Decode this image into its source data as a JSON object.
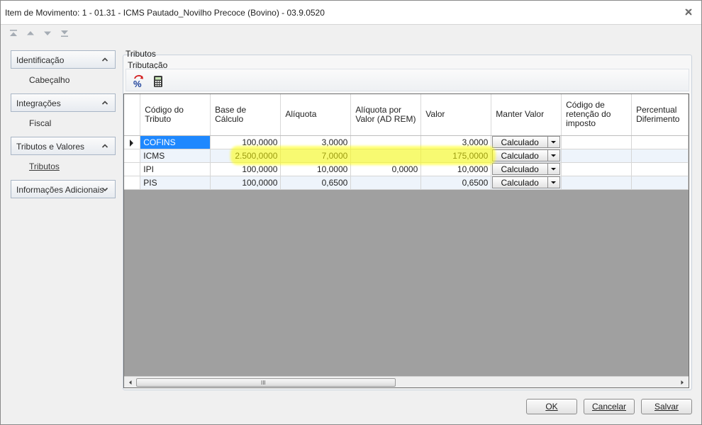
{
  "window": {
    "title": "Item de Movimento: 1 - 01.31 - ICMS Pautado_Novilho Precoce (Bovino) - 03.9.0520"
  },
  "sidebar": {
    "groups": [
      {
        "label": "Identificação",
        "items": [
          "Cabeçalho"
        ]
      },
      {
        "label": "Integrações",
        "items": [
          "Fiscal"
        ]
      },
      {
        "label": "Tributos e Valores",
        "items": [
          "Tributos"
        ]
      },
      {
        "label": "Informações Adicionais",
        "items": []
      }
    ]
  },
  "main": {
    "section_label": "Tributos",
    "subsection_label": "Tributação"
  },
  "grid": {
    "columns": [
      "Código do Tributo",
      "Base de Cálculo",
      "Alíquota",
      "Alíquota por Valor (AD REM)",
      "Valor",
      "Manter Valor",
      "Código de retenção do imposto",
      "Percentual Diferimento"
    ],
    "rows": [
      {
        "codigo": "COFINS",
        "base": "100,0000",
        "aliquota": "3,0000",
        "aliquota_valor": "",
        "valor": "3,0000",
        "manter": "Calculado"
      },
      {
        "codigo": "ICMS",
        "base": "2.500,0000",
        "aliquota": "7,0000",
        "aliquota_valor": "",
        "valor": "175,0000",
        "manter": "Calculado"
      },
      {
        "codigo": "IPI",
        "base": "100,0000",
        "aliquota": "10,0000",
        "aliquota_valor": "0,0000",
        "valor": "10,0000",
        "manter": "Calculado"
      },
      {
        "codigo": "PIS",
        "base": "100,0000",
        "aliquota": "0,6500",
        "aliquota_valor": "",
        "valor": "0,6500",
        "manter": "Calculado"
      }
    ],
    "scroll_grip": "III"
  },
  "buttons": {
    "ok_label": "OK",
    "cancel_label": "Cancelar",
    "save_label": "Salvar"
  },
  "colors": {
    "selection": "#1e88ff",
    "highlight": "#ffff00",
    "grid_empty": "#a0a0a0"
  }
}
